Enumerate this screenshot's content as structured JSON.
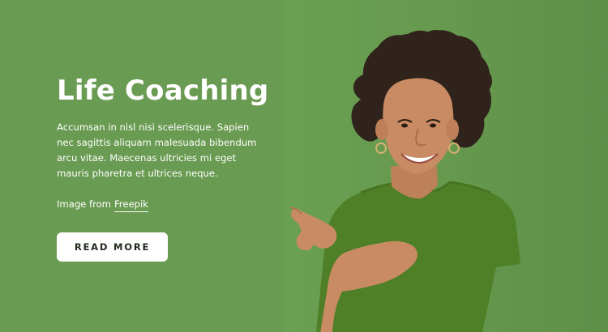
{
  "hero": {
    "title": "Life Coaching",
    "description": "Accumsan in nisl nisi scelerisque. Sapien nec sagittis aliquam malesuada bibendum arcu vitae. Maecenas ultricies mi eget mauris pharetra et ultrices neque.",
    "credit_prefix": "Image from",
    "credit_link": "Freepik",
    "button_label": "READ MORE"
  },
  "colors": {
    "background": "#6a9b52",
    "photo_background": "#67994f",
    "text": "#ffffff",
    "button_background": "#ffffff",
    "button_text": "#1f2a1c"
  }
}
